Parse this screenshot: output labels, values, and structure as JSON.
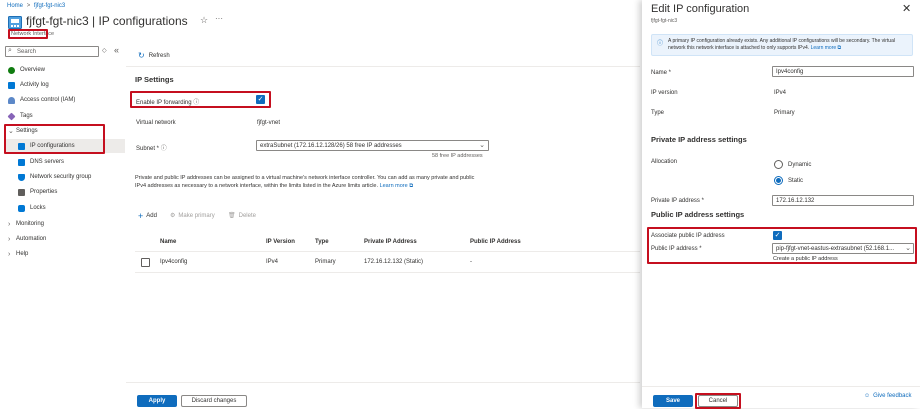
{
  "breadcrumb": {
    "home": "Home",
    "sep": ">",
    "current": "fjfgt-fgt-nic3"
  },
  "header": {
    "title": "fjfgt-fgt-nic3 | IP configurations",
    "subtitle": "Network Interface"
  },
  "search": {
    "placeholder": "Search"
  },
  "sidebar": {
    "items": [
      {
        "label": "Overview"
      },
      {
        "label": "Activity log"
      },
      {
        "label": "Access control (IAM)"
      },
      {
        "label": "Tags"
      },
      {
        "label": "Settings"
      },
      {
        "label": "IP configurations"
      },
      {
        "label": "DNS servers"
      },
      {
        "label": "Network security group"
      },
      {
        "label": "Properties"
      },
      {
        "label": "Locks"
      },
      {
        "label": "Monitoring"
      },
      {
        "label": "Automation"
      },
      {
        "label": "Help"
      }
    ]
  },
  "toolbar": {
    "refresh": "Refresh"
  },
  "ip_settings": {
    "heading": "IP Settings",
    "enable_forwarding_label": "Enable IP forwarding",
    "enable_forwarding_checked": true,
    "vnet_label": "Virtual network",
    "vnet_value": "fjfgt-vnet",
    "subnet_label": "Subnet *",
    "subnet_value": "extraSubnet (172.16.12.128/26) 58 free IP addresses",
    "subnet_hint": "58 free IP addresses",
    "info_text": "Private and public IP addresses can be assigned to a virtual machine's network interface controller. You can add as many private and public IPv4 addresses as necessary to a network interface, within the limits listed in the Azure limits article.",
    "learn_more": "Learn more"
  },
  "actions": {
    "add": "Add",
    "make_primary": "Make primary",
    "delete": "Delete"
  },
  "table": {
    "headers": [
      "Name",
      "IP Version",
      "Type",
      "Private IP Address",
      "Public IP Address"
    ],
    "rows": [
      {
        "name": "Ipv4config",
        "version": "IPv4",
        "type": "Primary",
        "private_ip": "172.16.12.132 (Static)",
        "public_ip": "-"
      }
    ]
  },
  "footer": {
    "apply": "Apply",
    "discard": "Discard changes"
  },
  "panel": {
    "title": "Edit IP configuration",
    "subtitle": "fjfgt-fgt-nic3",
    "info": "A primary IP configuration already exists. Any additional IP configurations will be secondary. The virtual network this network interface is attached to only supports IPv4.",
    "learn_more": "Learn more",
    "name_label": "Name *",
    "name_value": "Ipv4config",
    "version_label": "IP version",
    "version_value": "IPv4",
    "type_label": "Type",
    "type_value": "Primary",
    "private_heading": "Private IP address settings",
    "allocation_label": "Allocation",
    "dynamic": "Dynamic",
    "static": "Static",
    "allocation_selected": "Static",
    "private_ip_label": "Private IP address *",
    "private_ip_value": "172.16.12.132",
    "public_heading": "Public IP address settings",
    "assoc_label": "Associate public IP address",
    "assoc_checked": true,
    "public_ip_label": "Public IP address *",
    "public_ip_value": "pip-fjfgt-vnet-eastus-extrasubnet (52.168.1...",
    "create_public": "Create a public IP address",
    "save": "Save",
    "cancel": "Cancel",
    "feedback": "Give feedback"
  },
  "colors": {
    "accent": "#0f6cbd",
    "highlight_border": "#c50f1f",
    "info_bg": "#ebf3fc"
  }
}
